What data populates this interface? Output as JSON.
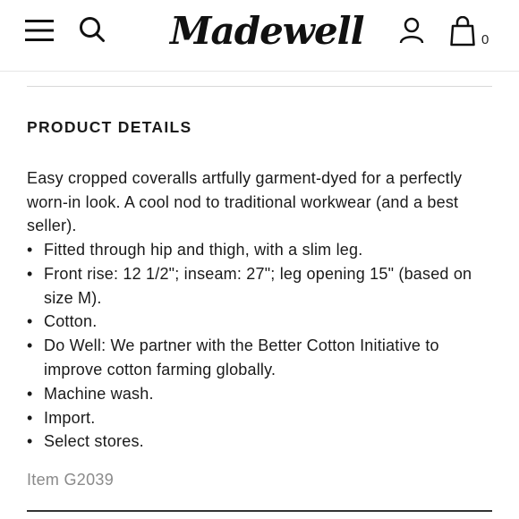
{
  "header": {
    "brand_name": "Madewell",
    "bag_count": "0"
  },
  "icons": {
    "menu": "menu-icon",
    "search": "search-icon",
    "account": "user-icon",
    "bag": "shopping-bag-icon"
  },
  "product_details": {
    "title": "PRODUCT DETAILS",
    "description": "Easy cropped coveralls artfully garment-dyed for a perfectly worn-in look. A cool nod to traditional workwear (and a best seller).",
    "bullets": [
      "Fitted through hip and thigh, with a slim leg.",
      "Front rise: 12 1/2\"; inseam: 27\"; leg opening 15\" (based on size M).",
      "Cotton.",
      "Do Well: We partner with the Better Cotton Initiative to improve cotton farming globally.",
      "Machine wash.",
      "Import.",
      "Select stores."
    ],
    "item_number": "Item G2039"
  }
}
